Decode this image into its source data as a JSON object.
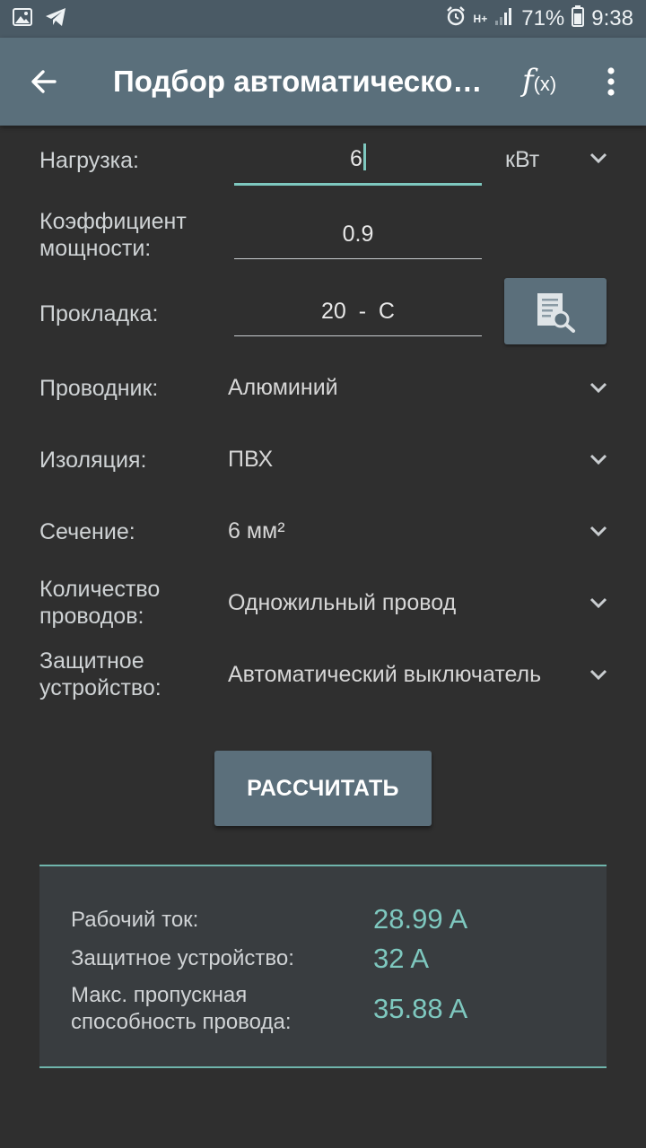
{
  "status_bar": {
    "network": "H+",
    "battery": "71%",
    "time": "9:38"
  },
  "app_bar": {
    "title": "Подбор автоматическо…",
    "formula_f": "f",
    "formula_x": "(x)"
  },
  "form": {
    "load": {
      "label": "Нагрузка:",
      "value": "6",
      "unit": "кВт"
    },
    "power_factor": {
      "label_1": "Коэффициент",
      "label_2": "мощности:",
      "value": "0.9"
    },
    "laying": {
      "label": "Прокладка:",
      "value": "20  -  C"
    },
    "conductor": {
      "label": "Проводник:",
      "value": "Алюминий"
    },
    "insulation": {
      "label": "Изоляция:",
      "value": "ПВХ"
    },
    "section": {
      "label": "Сечение:",
      "value": "6 мм²"
    },
    "wires_count": {
      "label_1": "Количество",
      "label_2": "проводов:",
      "value": "Одножильный провод"
    },
    "protection": {
      "label_1": "Защитное",
      "label_2": "устройство:",
      "value": "Автоматический выключатель"
    }
  },
  "calculate_label": "РАССЧИТАТЬ",
  "results": {
    "working_current": {
      "label": "Рабочий ток:",
      "value": "28.99 A"
    },
    "protective_device": {
      "label": "Защитное устройство:",
      "value": "32 A"
    },
    "max_capacity": {
      "label_1": "Макс. пропускная",
      "label_2": "способность провода:",
      "value": "35.88 A"
    }
  },
  "colors": {
    "accent": "#7ec8bf",
    "appbar": "#5a6f7b",
    "background": "#2f2f2f"
  }
}
